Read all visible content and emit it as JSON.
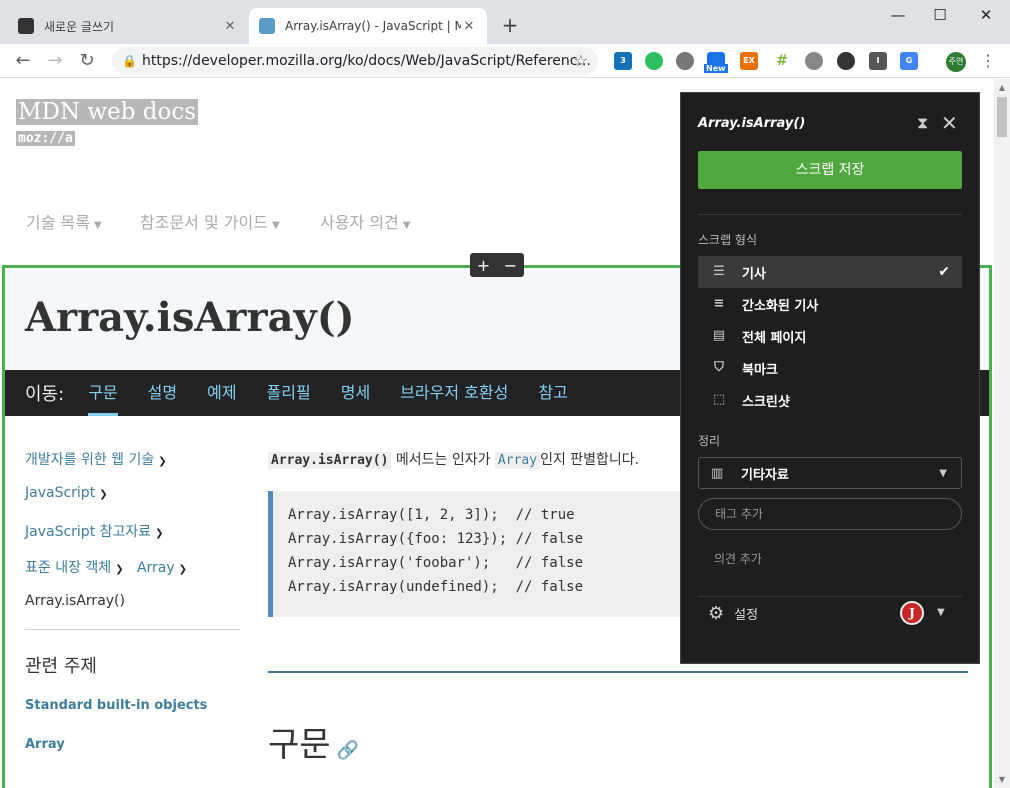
{
  "browser": {
    "tabs": [
      {
        "title": "새로운 글쓰기",
        "close": "✕"
      },
      {
        "title": "Array.isArray() - JavaScript | MDN",
        "close": "✕"
      }
    ],
    "new_tab": "+",
    "window": {
      "minimize": "—",
      "maximize": "☐",
      "close": "✕"
    },
    "url": "https://developer.mozilla.org/ko/docs/Web/JavaScript/Referenc...",
    "extensions": [
      "css-icon",
      "evernote-icon",
      "gear-icon",
      "new-ext-icon",
      "ex-icon",
      "ladder-icon",
      "globe-icon",
      "color-wheel-icon",
      "info-icon",
      "translate-icon"
    ],
    "new_badge": "New",
    "ex_label": "EX",
    "profile": "주연"
  },
  "mdn": {
    "logo": "MDN web docs",
    "logo_sub": "moz://a",
    "nav": [
      "기술 목록",
      "참조문서 및 가이드",
      "사용자 의견"
    ],
    "title": "Array.isArray()",
    "jump_label": "이동:",
    "jump_links": [
      "구문",
      "설명",
      "예제",
      "폴리필",
      "명세",
      "브라우저 호환성",
      "참고"
    ],
    "breadcrumbs": [
      "개발자를 위한 웹 기술",
      "JavaScript",
      "JavaScript 참고자료",
      "표준 내장 객체",
      "Array",
      "Array.isArray()"
    ],
    "related_heading": "관련 주제",
    "related_links": [
      "Standard built-in objects",
      "Array"
    ],
    "intro": {
      "code1": "Array.isArray()",
      "text1": " 메서드는 인자가 ",
      "code2": "Array",
      "text2": "인지 판별합니다."
    },
    "code_lines": [
      "Array.isArray([1, 2, 3]);  // true",
      "Array.isArray({foo: 123}); // false",
      "Array.isArray('foobar');   // false",
      "Array.isArray(undefined);  // false"
    ],
    "section_heading": "구문"
  },
  "panel": {
    "title": "Array.isArray()",
    "save_button": "스크랩 저장",
    "format_label": "스크랩 형식",
    "formats": [
      {
        "label": "기사",
        "icon": "article-icon",
        "selected": true
      },
      {
        "label": "간소화된 기사",
        "icon": "simplified-article-icon",
        "selected": false
      },
      {
        "label": "전체 페이지",
        "icon": "full-page-icon",
        "selected": false
      },
      {
        "label": "북마크",
        "icon": "bookmark-icon",
        "selected": false
      },
      {
        "label": "스크린샷",
        "icon": "screenshot-icon",
        "selected": false
      }
    ],
    "organize_label": "정리",
    "notebook": "기타자료",
    "tag_placeholder": "태그 추가",
    "comment_placeholder": "의견 추가",
    "settings": "설정",
    "account_initial": "J"
  },
  "colors": {
    "accent_green": "#51a83f",
    "link": "#3d7e9a",
    "jump_link": "#83d0f2"
  }
}
